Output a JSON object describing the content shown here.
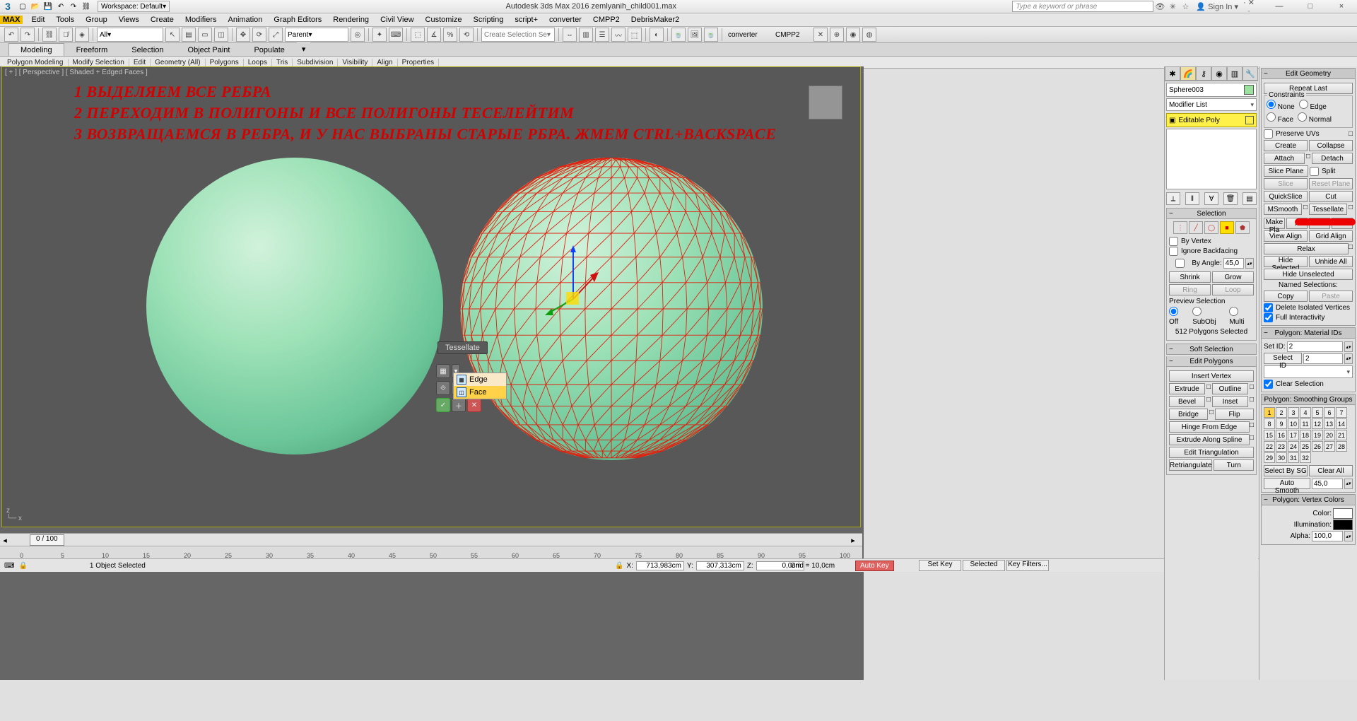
{
  "app": {
    "title": "Autodesk 3ds Max 2016     zemlyanih_child001.max",
    "workspace": "Workspace: Default",
    "search_placeholder": "Type a keyword or phrase",
    "signin": "Sign In",
    "wincontrols": [
      "—",
      "□",
      "×"
    ]
  },
  "menubar": [
    "Edit",
    "Tools",
    "Group",
    "Views",
    "Create",
    "Modifiers",
    "Animation",
    "Graph Editors",
    "Rendering",
    "Civil View",
    "Customize",
    "Scripting",
    "script+",
    "converter",
    "CMPP2",
    "DebrisMaker2"
  ],
  "maintb": {
    "selfilter": "All",
    "refcoord": "Parent",
    "create_sel": "Create Selection Se",
    "extra": [
      "converter",
      "CMPP2"
    ]
  },
  "ribbon": {
    "tabs": [
      "Modeling",
      "Freeform",
      "Selection",
      "Object Paint",
      "Populate"
    ],
    "active": "Modeling",
    "sub": [
      "Polygon Modeling",
      "Modify Selection",
      "Edit",
      "Geometry (All)",
      "Polygons",
      "Loops",
      "Tris",
      "Subdivision",
      "Visibility",
      "Align",
      "Properties"
    ]
  },
  "viewport": {
    "label": "[ + ] [ Perspective ] [ Shaded + Edged Faces ]",
    "overlays": [
      "1 ВЫДЕЛЯЕМ ВСЕ РЕБРА",
      "2 ПЕРЕХОДИМ В ПОЛИГОНЫ И ВСЕ ПОЛИГОНЫ ТЕСЕЛЕЙТИМ",
      "3 ВОЗВРАЩАЕМСЯ В РЕБРА, И У НАС ВЫБРАНЫ СТАРЫЕ РБРА. ЖМЕМ CTRL+BACKSPACE"
    ],
    "popup_label": "Tessellate",
    "flyout": {
      "edge": "Edge",
      "face": "Face"
    }
  },
  "time": {
    "pos": "0 / 100",
    "ticks": [
      "0",
      "5",
      "10",
      "15",
      "20",
      "25",
      "30",
      "35",
      "40",
      "45",
      "50",
      "55",
      "60",
      "65",
      "70",
      "75",
      "80",
      "85",
      "90",
      "95",
      "100"
    ]
  },
  "status": {
    "objsel": "1 Object Selected",
    "x": "713,983cm",
    "y": "307,313cm",
    "z": "0,0cm",
    "grid": "Grid = 10,0cm",
    "autokey": "Auto Key",
    "setkey": "Set Key",
    "selected": "Selected",
    "keyfilters": "Key Filters..."
  },
  "cmd": {
    "object_name": "Sphere003",
    "modifier_list": "Modifier List",
    "modifier": "Editable Poly",
    "selection": {
      "title": "Selection",
      "by_vertex": "By Vertex",
      "ignore_backfacing": "Ignore Backfacing",
      "by_angle": "By Angle:",
      "by_angle_val": "45,0",
      "shrink": "Shrink",
      "grow": "Grow",
      "ring": "Ring",
      "loop": "Loop",
      "preview": "Preview Selection",
      "off": "Off",
      "subobj": "SubObj",
      "multi": "Multi",
      "count": "512 Polygons Selected"
    },
    "rollouts": {
      "soft_selection": "Soft Selection",
      "edit_polygons": "Edit Polygons",
      "insert_vertex": "Insert Vertex",
      "extrude": "Extrude",
      "outline": "Outline",
      "bevel": "Bevel",
      "inset": "Inset",
      "bridge": "Bridge",
      "flip": "Flip",
      "hinge": "Hinge From Edge",
      "extrude_spline": "Extrude Along Spline",
      "edit_tri": "Edit Triangulation",
      "retri": "Retriangulate",
      "turn": "Turn"
    }
  },
  "cmd2": {
    "edit_geometry": "Edit Geometry",
    "repeat_last": "Repeat Last",
    "constraints": "Constraints",
    "none": "None",
    "edge": "Edge",
    "face": "Face",
    "normal": "Normal",
    "preserve_uvs": "Preserve UVs",
    "create": "Create",
    "collapse": "Collapse",
    "attach": "Attach",
    "detach": "Detach",
    "slice_plane": "Slice Plane",
    "split": "Split",
    "slice": "Slice",
    "reset_plane": "Reset Plane",
    "quickslice": "QuickSlice",
    "cut": "Cut",
    "msmooth": "MSmooth",
    "tessellate": "Tessellate",
    "make_planar": "Make Pla",
    "view_align": "View Align",
    "grid_align": "Grid Align",
    "relax": "Relax",
    "hide_selected": "Hide Selected",
    "unhide_all": "Unhide All",
    "hide_unselected": "Hide Unselected",
    "named_sel": "Named Selections:",
    "copy": "Copy",
    "paste": "Paste",
    "del_iso": "Delete Isolated Vertices",
    "full_int": "Full Interactivity",
    "mat_ids": "Polygon: Material IDs",
    "set_id": "Set ID:",
    "set_id_val": "2",
    "select_id": "Select ID",
    "select_id_val": "2",
    "clear_sel": "Clear Selection",
    "smoothing": "Polygon: Smoothing Groups",
    "sel_by_sg": "Select By SG",
    "clear_all": "Clear All",
    "auto_smooth": "Auto Smooth",
    "auto_smooth_val": "45,0",
    "vertex_colors": "Polygon: Vertex Colors",
    "color": "Color:",
    "illum": "Illumination:",
    "alpha": "Alpha:",
    "alpha_val": "100,0"
  }
}
